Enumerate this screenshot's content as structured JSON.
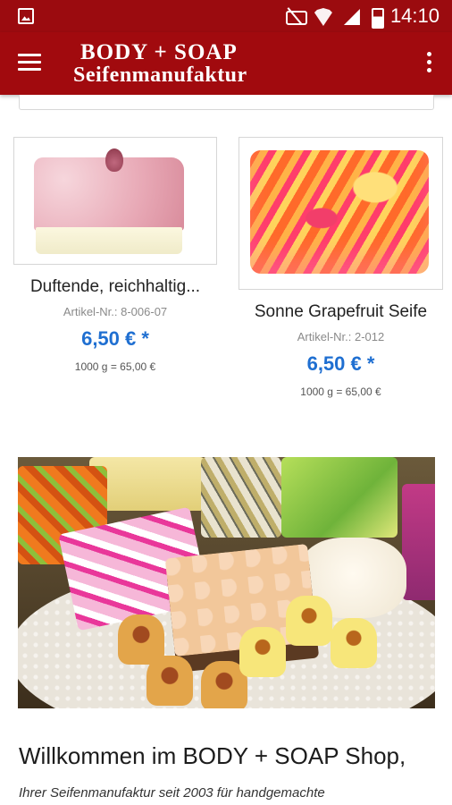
{
  "status_bar": {
    "time": "14:10",
    "icons": [
      "gallery-icon",
      "mute-icon",
      "wifi-icon",
      "signal-icon",
      "battery-icon"
    ]
  },
  "app_bar": {
    "logo_line1": "BODY + SOAP",
    "logo_line2": "Seifenmanufaktur",
    "menu_icon": "hamburger-icon",
    "overflow_icon": "overflow-menu-icon",
    "color": "#a10a0e"
  },
  "products": [
    {
      "name": "Duftende, reichhaltig...",
      "sku": "Artikel-Nr.: 8-006-07",
      "price": "6,50 € *",
      "unit_price": "1000 g = 65,00 €"
    },
    {
      "name": "Sonne Grapefruit Seife",
      "sku": "Artikel-Nr.: 2-012",
      "price": "6,50 € *",
      "unit_price": "1000 g = 65,00 €"
    }
  ],
  "welcome": {
    "title": "Willkommen im BODY + SOAP Shop,",
    "subtitle": "Ihrer Seifenmanufaktur seit 2003 für handgemachte"
  },
  "colors": {
    "accent": "#a10a0e",
    "price": "#1f6fd1"
  }
}
